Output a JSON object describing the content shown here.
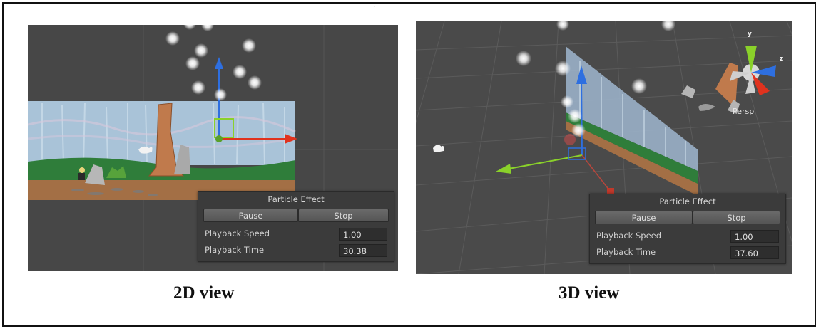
{
  "views": [
    {
      "caption": "2D view",
      "particle_effect": {
        "title": "Particle Effect",
        "pause_label": "Pause",
        "stop_label": "Stop",
        "speed_label": "Playback Speed",
        "speed_value": "1.00",
        "time_label": "Playback Time",
        "time_value": "30.38"
      }
    },
    {
      "caption": "3D view",
      "particle_effect": {
        "title": "Particle Effect",
        "pause_label": "Pause",
        "stop_label": "Stop",
        "speed_label": "Playback Speed",
        "speed_value": "1.00",
        "time_label": "Playback Time",
        "time_value": "37.60"
      },
      "gizmo": {
        "projection_label": "Persp",
        "axis_y": "y",
        "axis_z": "z"
      }
    }
  ],
  "colors": {
    "scene_bg": "#474747",
    "sky": "#a9c3d8",
    "grass": "#2f7d3a",
    "dirt": "#a36f45",
    "axis_x": "#e0321e",
    "axis_y": "#8ad12a",
    "axis_z": "#2e6fe0"
  }
}
